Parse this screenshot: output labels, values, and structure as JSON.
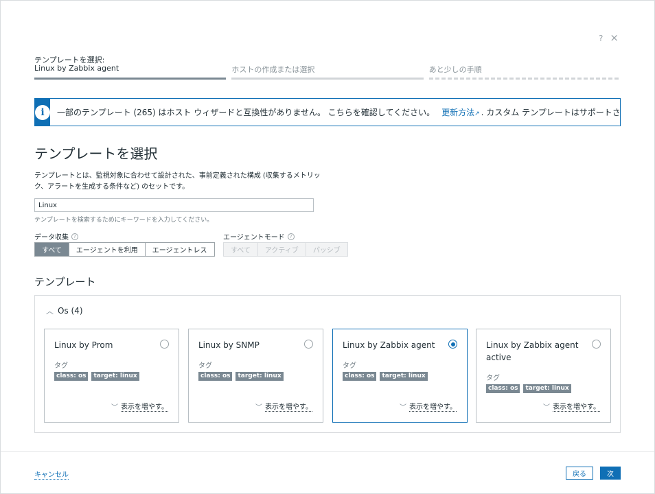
{
  "window": {
    "help": "?",
    "close": "×"
  },
  "steps": [
    {
      "title": "テンプレートを選択:",
      "subtitle": "Linux by Zabbix agent"
    },
    {
      "title": "",
      "subtitle": "ホストの作成または選択"
    },
    {
      "title": "",
      "subtitle": "あと少しの手順"
    }
  ],
  "info": {
    "icon": "i",
    "text": "一部のテンプレート (265) はホスト ウィザードと互換性がありません。 こちらを確認してください。",
    "link": "更新方法",
    "after": ". カスタム テンプレートはサポートされていません。"
  },
  "page": {
    "title": "テンプレートを選択",
    "description": "テンプレートとは、監視対象に合わせて設計された、事前定義された構成 (収集するメトリック、アラートを生成する条件など) のセットです。"
  },
  "search": {
    "value": "Linux",
    "hint": "テンプレートを検索するためにキーワードを入力してください。"
  },
  "data_collection": {
    "label": "データ収集",
    "options": [
      "すべて",
      "エージェントを利用",
      "エージェントレス"
    ],
    "selected": "すべて"
  },
  "agent_mode": {
    "label": "エージェントモード",
    "options": [
      "すべて",
      "アクティブ",
      "パッシブ"
    ]
  },
  "templates": {
    "section_title": "テンプレート",
    "group": "Os (4)",
    "tag_label": "タグ",
    "more_label": "表示を増やす。",
    "cards": [
      {
        "title": "Linux by Prom",
        "tags": [
          "class: os",
          "target: linux"
        ],
        "selected": false
      },
      {
        "title": "Linux by SNMP",
        "tags": [
          "class: os",
          "target: linux"
        ],
        "selected": false
      },
      {
        "title": "Linux by Zabbix agent",
        "tags": [
          "class: os",
          "target: linux"
        ],
        "selected": true
      },
      {
        "title": "Linux by Zabbix agent active",
        "tags": [
          "class: os",
          "target: linux"
        ],
        "selected": false
      }
    ]
  },
  "footer": {
    "cancel": "キャンセル",
    "back": "戻る",
    "next": "次"
  },
  "colors": {
    "accent": "#0f6fb5",
    "tag": "#7a8892"
  }
}
